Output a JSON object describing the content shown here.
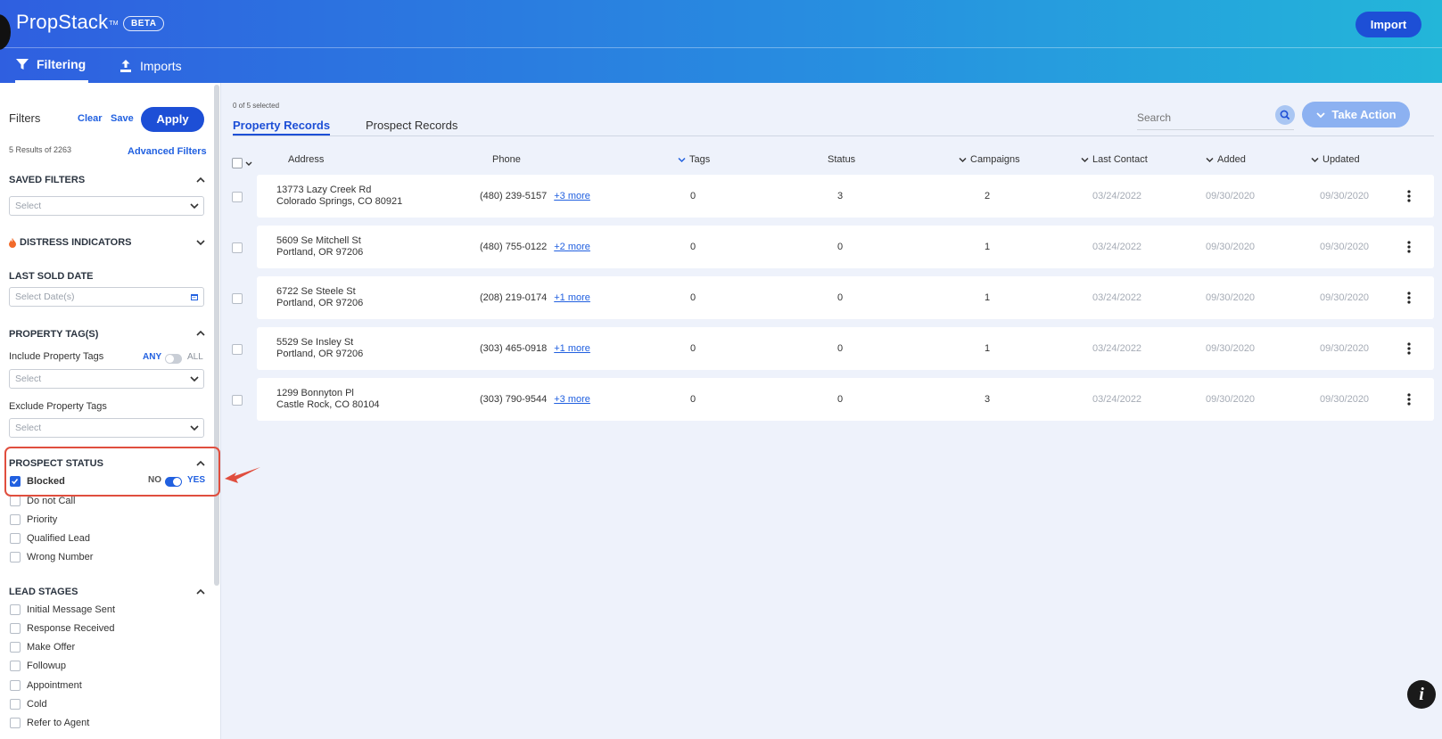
{
  "header": {
    "brand": "PropStack",
    "trademark": "TM",
    "beta": "BETA",
    "import_label": "Import",
    "tabs": [
      {
        "label": "Filtering",
        "icon": "filter-icon",
        "active": true
      },
      {
        "label": "Imports",
        "icon": "upload-icon",
        "active": false
      }
    ]
  },
  "sidebar": {
    "title": "Filters",
    "clear": "Clear",
    "save": "Save",
    "apply": "Apply",
    "results": "5 Results of 2263",
    "advanced": "Advanced Filters",
    "saved_filters": {
      "title": "SAVED FILTERS",
      "placeholder": "Select"
    },
    "distress": {
      "title": "DISTRESS INDICATORS",
      "icon": "flame-icon"
    },
    "last_sold": {
      "title": "LAST SOLD DATE",
      "placeholder": "Select Date(s)"
    },
    "property_tags": {
      "title": "PROPERTY TAG(S)",
      "include_label": "Include Property Tags",
      "any": "ANY",
      "all": "ALL",
      "include_placeholder": "Select",
      "exclude_label": "Exclude Property Tags",
      "exclude_placeholder": "Select"
    },
    "prospect_status": {
      "title": "PROSPECT STATUS",
      "no": "NO",
      "yes": "YES",
      "items": [
        {
          "label": "Blocked",
          "checked": true
        },
        {
          "label": "Do not Call",
          "checked": false
        },
        {
          "label": "Priority",
          "checked": false
        },
        {
          "label": "Qualified Lead",
          "checked": false
        },
        {
          "label": "Wrong Number",
          "checked": false
        }
      ]
    },
    "lead_stages": {
      "title": "LEAD STAGES",
      "items": [
        {
          "label": "Initial Message Sent",
          "checked": false
        },
        {
          "label": "Response Received",
          "checked": false
        },
        {
          "label": "Make Offer",
          "checked": false
        },
        {
          "label": "Followup",
          "checked": false
        },
        {
          "label": "Appointment",
          "checked": false
        },
        {
          "label": "Cold",
          "checked": false
        },
        {
          "label": "Refer to Agent",
          "checked": false
        }
      ]
    }
  },
  "main": {
    "selected": "0 of 5 selected",
    "tabs": [
      "Property Records",
      "Prospect Records"
    ],
    "search_placeholder": "Search",
    "take_action": "Take Action",
    "columns": [
      "Address",
      "Phone",
      "Tags",
      "Status",
      "Campaigns",
      "Last Contact",
      "Added",
      "Updated"
    ],
    "rows": [
      {
        "address1": "13773 Lazy Creek Rd",
        "address2": "Colorado Springs, CO 80921",
        "phone": "(480) 239-5157",
        "more": "+3 more",
        "tags": "0",
        "status": "3",
        "campaigns": "2",
        "last_contact": "03/24/2022",
        "added": "09/30/2020",
        "updated": "09/30/2020"
      },
      {
        "address1": "5609 Se Mitchell St",
        "address2": "Portland, OR 97206",
        "phone": "(480) 755-0122",
        "more": "+2 more",
        "tags": "0",
        "status": "0",
        "campaigns": "1",
        "last_contact": "03/24/2022",
        "added": "09/30/2020",
        "updated": "09/30/2020"
      },
      {
        "address1": "6722 Se Steele St",
        "address2": "Portland, OR 97206",
        "phone": "(208) 219-0174",
        "more": "+1 more",
        "tags": "0",
        "status": "0",
        "campaigns": "1",
        "last_contact": "03/24/2022",
        "added": "09/30/2020",
        "updated": "09/30/2020"
      },
      {
        "address1": "5529 Se Insley St",
        "address2": "Portland, OR 97206",
        "phone": "(303) 465-0918",
        "more": "+1 more",
        "tags": "0",
        "status": "0",
        "campaigns": "1",
        "last_contact": "03/24/2022",
        "added": "09/30/2020",
        "updated": "09/30/2020"
      },
      {
        "address1": "1299 Bonnyton Pl",
        "address2": "Castle Rock, CO 80104",
        "phone": "(303) 790-9544",
        "more": "+3 more",
        "tags": "0",
        "status": "0",
        "campaigns": "3",
        "last_contact": "03/24/2022",
        "added": "09/30/2020",
        "updated": "09/30/2020"
      }
    ]
  },
  "info_icon": "info-icon",
  "colors": {
    "accent": "#1d4fd6",
    "link": "#2160e0",
    "highlight": "#e04e3e"
  }
}
